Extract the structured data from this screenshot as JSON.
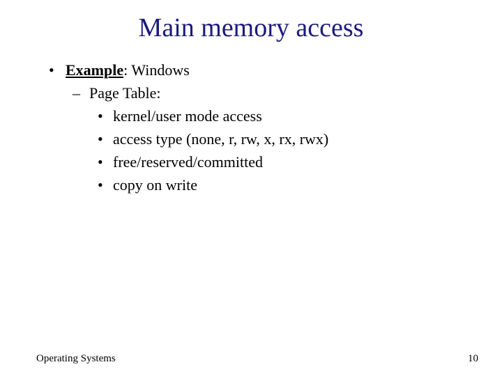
{
  "title": "Main memory access",
  "body": {
    "example_label": "Example",
    "example_value": ": Windows",
    "page_table_label": "Page Table:",
    "items": [
      "kernel/user mode access",
      "access type (none, r, rw, x, rx, rwx)",
      "free/reserved/committed",
      "copy on write"
    ]
  },
  "footer": {
    "left": "Operating Systems",
    "page_number": "10"
  }
}
